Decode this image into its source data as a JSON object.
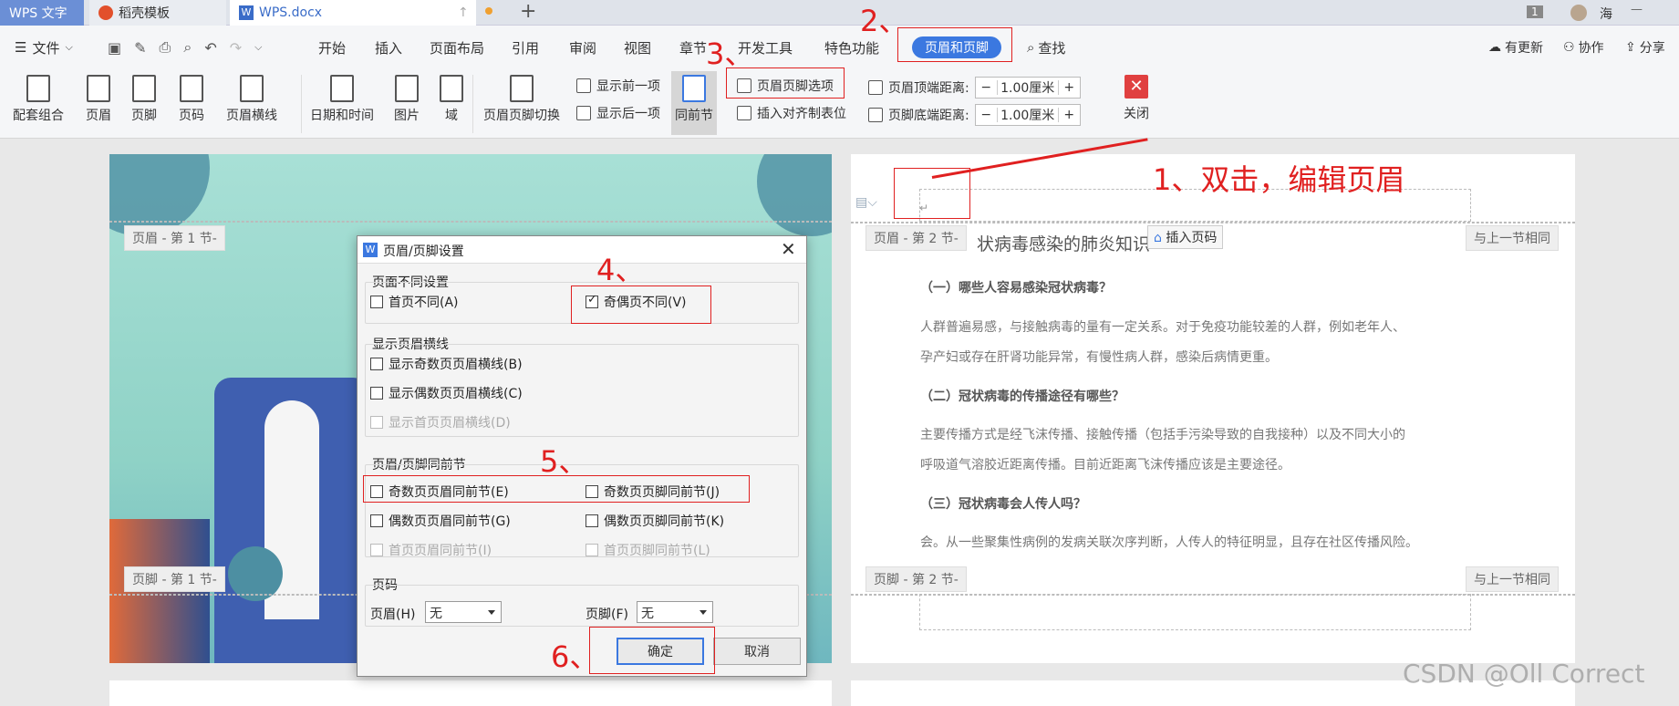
{
  "tabs": {
    "app": "WPS 文字",
    "template": "稻壳模板",
    "doc": "WPS.docx",
    "count": "1",
    "user": "海"
  },
  "menu": {
    "file": "文件",
    "items": [
      "开始",
      "插入",
      "页面布局",
      "引用",
      "审阅",
      "视图",
      "章节",
      "开发工具",
      "特色功能"
    ],
    "active": "页眉和页脚",
    "find": "查找",
    "update": "有更新",
    "collab": "协作",
    "share": "分享"
  },
  "ribbon": {
    "combo": "配套组合",
    "header": "页眉",
    "footer": "页脚",
    "pagenum": "页码",
    "hline": "页眉横线",
    "datetime": "日期和时间",
    "picture": "图片",
    "field": "域",
    "switch": "页眉页脚切换",
    "prev": "显示前一项",
    "next": "显示后一项",
    "same": "同前节",
    "options": "页眉页脚选项",
    "align": "插入对齐制表位",
    "top_label": "页眉顶端距离:",
    "top_val": "1.00厘米",
    "bottom_label": "页脚底端距离:",
    "bottom_val": "1.00厘米",
    "close": "关闭"
  },
  "annotations": {
    "n1": "1、双击，编辑页眉",
    "n2": "2、",
    "n3": "3、",
    "n4": "4、",
    "n5": "5、",
    "n6": "6、"
  },
  "left_page": {
    "header_tag": "页眉 - 第 1 节-",
    "footer_tag": "页脚 - 第 1 节-"
  },
  "right_page": {
    "header_tag": "页眉 - 第 2 节-",
    "footer_tag": "页脚 - 第 2 节-",
    "same_tag": "与上一节相同",
    "insert_pn": "插入页码",
    "title": "状病毒感染的肺炎知识",
    "q1": "（一）哪些人容易感染冠状病毒？",
    "p1a": "人群普遍易感，与接触病毒的量有一定关系。对于免疫功能较差的人群，例如老年人、",
    "p1b": "孕产妇或存在肝肾功能异常，有慢性病人群，感染后病情更重。",
    "q2": "（二）冠状病毒的传播途径有哪些？",
    "p2a": "主要传播方式是经飞沫传播、接触传播（包括手污染导致的自我接种）以及不同大小的",
    "p2b": "呼吸道气溶胶近距离传播。目前近距离飞沫传播应该是主要途径。",
    "q3": "（三）冠状病毒会人传人吗？",
    "p3": "会。从一些聚集性病例的发病关联次序判断，人传人的特征明显，且存在社区传播风险。"
  },
  "dialog": {
    "title": "页眉/页脚设置",
    "g1": "页面不同设置",
    "first_diff": "首页不同(A)",
    "odd_even": "奇偶页不同(V)",
    "g2": "显示页眉横线",
    "odd_line": "显示奇数页页眉横线(B)",
    "even_line": "显示偶数页页眉横线(C)",
    "first_line": "显示首页页眉横线(D)",
    "g3": "页眉/页脚同前节",
    "odd_hdr": "奇数页页眉同前节(E)",
    "odd_ftr": "奇数页页脚同前节(J)",
    "even_hdr": "偶数页页眉同前节(G)",
    "even_ftr": "偶数页页脚同前节(K)",
    "first_hdr": "首页页眉同前节(I)",
    "first_ftr": "首页页脚同前节(L)",
    "g4": "页码",
    "hdr_label": "页眉(H)",
    "hdr_val": "无",
    "ftr_label": "页脚(F)",
    "ftr_val": "无",
    "ok": "确定",
    "cancel": "取消"
  },
  "watermark": "CSDN @Oll Correct"
}
